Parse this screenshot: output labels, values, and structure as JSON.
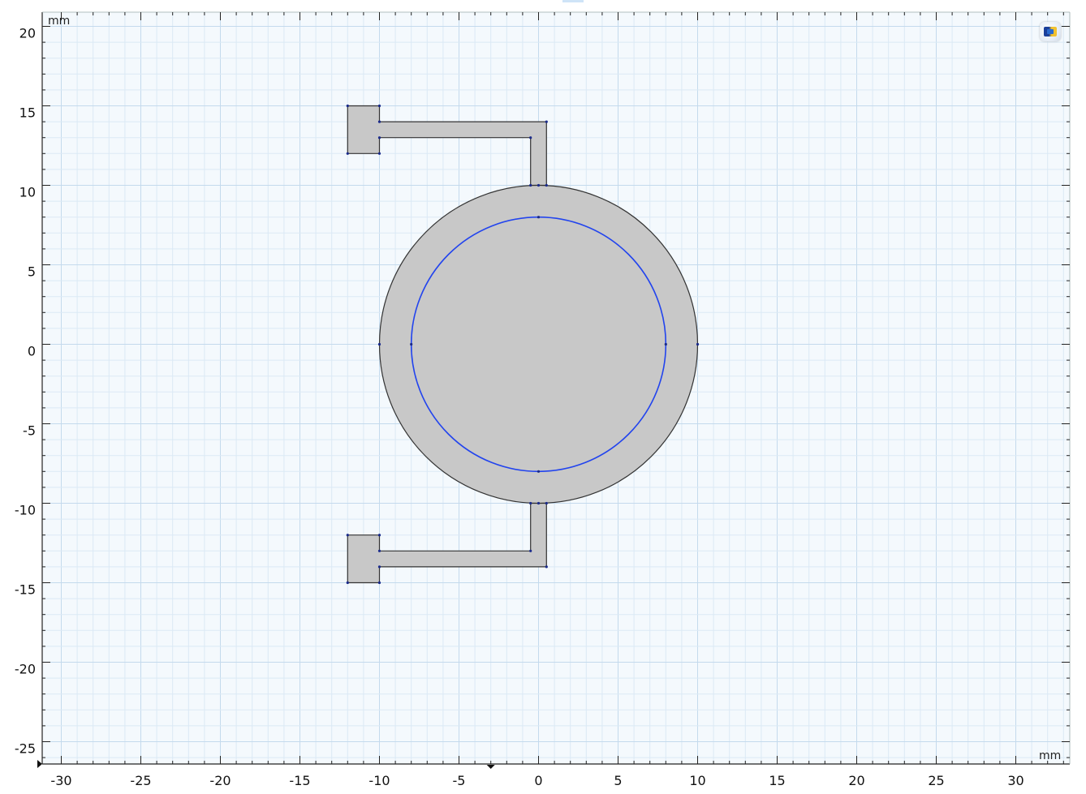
{
  "window": {
    "title": ""
  },
  "axes": {
    "x_unit": "mm",
    "y_unit": "mm",
    "x_range": [
      -30.5,
      33
    ],
    "y_range": [
      -26,
      20.5
    ],
    "x_ticks": [
      {
        "value": -30,
        "label": "-30"
      },
      {
        "value": -25,
        "label": "-25"
      },
      {
        "value": -20,
        "label": "-20"
      },
      {
        "value": -15,
        "label": "-15"
      },
      {
        "value": -10,
        "label": "-10"
      },
      {
        "value": -5,
        "label": "-5"
      },
      {
        "value": 0,
        "label": "0"
      },
      {
        "value": 5,
        "label": "5"
      },
      {
        "value": 10,
        "label": "10"
      },
      {
        "value": 15,
        "label": "15"
      },
      {
        "value": 20,
        "label": "20"
      },
      {
        "value": 25,
        "label": "25"
      },
      {
        "value": 30,
        "label": "30"
      }
    ],
    "y_ticks": [
      {
        "value": 20,
        "label": "20"
      },
      {
        "value": 15,
        "label": "15"
      },
      {
        "value": 10,
        "label": "10"
      },
      {
        "value": 5,
        "label": "5"
      },
      {
        "value": 0,
        "label": "0"
      },
      {
        "value": -5,
        "label": "-5"
      },
      {
        "value": -10,
        "label": "-10"
      },
      {
        "value": -15,
        "label": "-15"
      },
      {
        "value": -20,
        "label": "-20"
      },
      {
        "value": -25,
        "label": "-25"
      }
    ],
    "grid_minor_step": 1,
    "grid_major_step": 5
  },
  "colors": {
    "canvas_bg": "#f4f9fd",
    "grid_minor": "#dbe9f5",
    "grid_major": "#c4daed",
    "geometry_fill": "#c8c8c8",
    "geometry_edge": "#333333",
    "selected_edge": "#2244ee",
    "vertex": "#1a2a8a"
  },
  "geometry": {
    "outer_circle": {
      "cx": 0,
      "cy": 0,
      "r": 10
    },
    "inner_circle": {
      "cx": 0,
      "cy": 0,
      "r": 8
    },
    "upper_feed": [
      [
        -12,
        15
      ],
      [
        -10,
        15
      ],
      [
        -10,
        14
      ],
      [
        0.5,
        14
      ],
      [
        0.5,
        10
      ],
      [
        -0.5,
        10
      ],
      [
        -0.5,
        13
      ],
      [
        -10,
        13
      ],
      [
        -10,
        12
      ],
      [
        -12,
        12
      ]
    ],
    "lower_feed": [
      [
        -12,
        -12
      ],
      [
        -10,
        -12
      ],
      [
        -10,
        -13
      ],
      [
        -0.5,
        -13
      ],
      [
        -0.5,
        -10
      ],
      [
        0.5,
        -10
      ],
      [
        0.5,
        -14
      ],
      [
        -10,
        -14
      ],
      [
        -10,
        -15
      ],
      [
        -12,
        -15
      ]
    ],
    "vertices": [
      [
        -12,
        15
      ],
      [
        -10,
        15
      ],
      [
        -10,
        14
      ],
      [
        0.5,
        14
      ],
      [
        0.5,
        10
      ],
      [
        -0.5,
        10
      ],
      [
        -0.5,
        13
      ],
      [
        -10,
        13
      ],
      [
        -10,
        12
      ],
      [
        -12,
        12
      ],
      [
        -12,
        -12
      ],
      [
        -10,
        -12
      ],
      [
        -10,
        -13
      ],
      [
        -0.5,
        -13
      ],
      [
        -0.5,
        -10
      ],
      [
        0.5,
        -10
      ],
      [
        0.5,
        -14
      ],
      [
        -10,
        -14
      ],
      [
        -10,
        -15
      ],
      [
        -12,
        -15
      ],
      [
        -10,
        0
      ],
      [
        10,
        0
      ],
      [
        -8,
        0
      ],
      [
        8,
        0
      ],
      [
        0,
        8
      ],
      [
        0,
        -8
      ],
      [
        0,
        10
      ],
      [
        0,
        -10
      ]
    ]
  },
  "toolbar": {
    "logo_icon": "comsol-logo-icon"
  }
}
